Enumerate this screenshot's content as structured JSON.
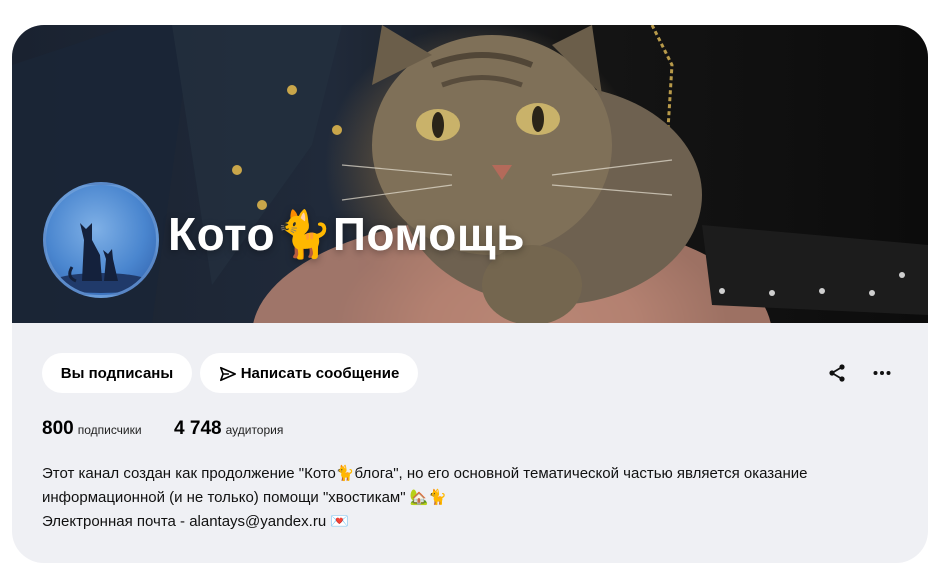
{
  "channel": {
    "name": "Кото🐈Помощь"
  },
  "actions": {
    "subscribed_label": "Вы подписаны",
    "message_label": "Написать сообщение",
    "share_icon": "share-icon",
    "more_icon": "more-icon"
  },
  "stats": {
    "subscribers_count": "800",
    "subscribers_label": "подписчики",
    "audience_count": "4 748",
    "audience_label": "аудитория"
  },
  "description": {
    "line1": "Этот канал создан как продолжение \"Кото🐈блога\", но его основной тематической частью является оказание",
    "line2": "информационной (и не только) помощи \"хвостикам\" 🏡🐈",
    "line3": "Электронная почта - alantays@yandex.ru 💌"
  }
}
